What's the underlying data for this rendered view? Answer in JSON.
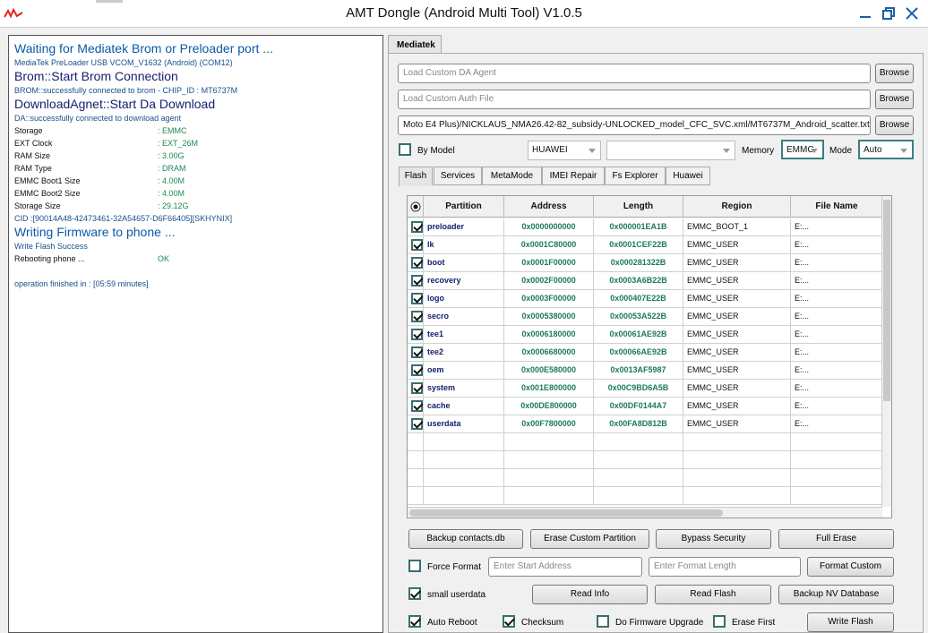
{
  "window": {
    "title": "AMT Dongle (Android Multi Tool) V1.0.5"
  },
  "log": {
    "lines": [
      {
        "cls": "h",
        "text": "Waiting for Mediatek Brom or Preloader port ..."
      },
      {
        "cls": "s",
        "text": "MediaTek PreLoader USB VCOM_V1632 (Android) (COM12)"
      },
      {
        "cls": "h dark",
        "text": "Brom::Start Brom Connection"
      },
      {
        "cls": "s",
        "text": "BROM::successfully connected to brom - CHIP_ID : MT6737M"
      },
      {
        "cls": "h dark",
        "text": "DownloadAgnet::Start Da Download"
      },
      {
        "cls": "s",
        "text": "DA::successfully connected to download agent"
      }
    ],
    "info": [
      {
        "k": "Storage",
        "v": ": EMMC"
      },
      {
        "k": "EXT Clock",
        "v": ": EXT_26M"
      },
      {
        "k": "RAM Size",
        "v": ": 3.00G"
      },
      {
        "k": "RAM Type",
        "v": ": DRAM"
      },
      {
        "k": "EMMC Boot1 Size",
        "v": ": 4.00M"
      },
      {
        "k": "EMMC Boot2 Size",
        "v": ": 4.00M"
      },
      {
        "k": "Storage Size",
        "v": ": 29.12G"
      }
    ],
    "cid": "CID :[90014A48-42473461-32A54657-D6F66405][SKHYNIX]",
    "writing": "Writing Firmware to phone ...",
    "write_success": "Write Flash Success",
    "rebooting": "Rebooting phone ...",
    "rebooting_status": "OK",
    "finished": "operation finished in : [05:59 minutes]"
  },
  "main_tab": "Mediatek",
  "da_agent": {
    "placeholder": "Load Custom DA Agent",
    "browse": "Browse"
  },
  "auth_file": {
    "placeholder": "Load Custom Auth File",
    "browse": "Browse"
  },
  "scatter": {
    "value": "Moto E4 Plus)/NICKLAUS_NMA26.42-82_subsidy-UNLOCKED_model_CFC_SVC.xml/MT6737M_Android_scatter.txt",
    "browse": "Browse"
  },
  "by_model": {
    "label": "By Model",
    "brand": "HUAWEI",
    "model": "",
    "memory_label": "Memory",
    "memory": "EMMC",
    "mode_label": "Mode",
    "mode": "Auto"
  },
  "tabs": [
    "Flash",
    "Services",
    "MetaMode",
    "IMEI Repair",
    "Fs Explorer",
    "Huawei"
  ],
  "table": {
    "headers": [
      "Partition",
      "Address",
      "Length",
      "Region",
      "File Name"
    ],
    "rows": [
      {
        "partition": "preloader",
        "address": "0x0000000000",
        "length": "0x000001EA1B",
        "region": "EMMC_BOOT_1",
        "file": "E:..."
      },
      {
        "partition": "lk",
        "address": "0x0001C80000",
        "length": "0x0001CEF22B",
        "region": "EMMC_USER",
        "file": "E:..."
      },
      {
        "partition": "boot",
        "address": "0x0001F00000",
        "length": "0x000281322B",
        "region": "EMMC_USER",
        "file": "E:..."
      },
      {
        "partition": "recovery",
        "address": "0x0002F00000",
        "length": "0x0003A6B22B",
        "region": "EMMC_USER",
        "file": "E:..."
      },
      {
        "partition": "logo",
        "address": "0x0003F00000",
        "length": "0x000407E22B",
        "region": "EMMC_USER",
        "file": "E:..."
      },
      {
        "partition": "secro",
        "address": "0x0005380000",
        "length": "0x00053A522B",
        "region": "EMMC_USER",
        "file": "E:..."
      },
      {
        "partition": "tee1",
        "address": "0x0006180000",
        "length": "0x00061AE92B",
        "region": "EMMC_USER",
        "file": "E:..."
      },
      {
        "partition": "tee2",
        "address": "0x0006680000",
        "length": "0x00066AE92B",
        "region": "EMMC_USER",
        "file": "E:..."
      },
      {
        "partition": "oem",
        "address": "0x000E580000",
        "length": "0x0013AF5987",
        "region": "EMMC_USER",
        "file": "E:..."
      },
      {
        "partition": "system",
        "address": "0x001E800000",
        "length": "0x00C9BD6A5B",
        "region": "EMMC_USER",
        "file": "E:..."
      },
      {
        "partition": "cache",
        "address": "0x00DE800000",
        "length": "0x00DF0144A7",
        "region": "EMMC_USER",
        "file": "E:..."
      },
      {
        "partition": "userdata",
        "address": "0x00F7800000",
        "length": "0x00FA8D812B",
        "region": "EMMC_USER",
        "file": "E:..."
      }
    ]
  },
  "buttons": {
    "backup_contacts": "Backup contacts.db",
    "erase_custom": "Erase Custom Partition",
    "bypass_security": "Bypass Security",
    "full_erase": "Full Erase",
    "format_custom": "Format Custom",
    "read_info": "Read Info",
    "read_flash": "Read Flash",
    "backup_nv": "Backup NV Database",
    "write_flash": "Write Flash"
  },
  "options": {
    "force_format": "Force Format",
    "start_address_placeholder": "Enter Start Address",
    "format_length_placeholder": "Enter Format Length",
    "small_userdata": "small userdata",
    "auto_reboot": "Auto Reboot",
    "checksum": "Checksum",
    "do_fw_upgrade": "Do Firmware Upgrade",
    "erase_first": "Erase First"
  },
  "colors": {
    "log_blue": "#0a5aa8",
    "log_green": "#1d8a54",
    "accent": "#3b6e6e"
  }
}
